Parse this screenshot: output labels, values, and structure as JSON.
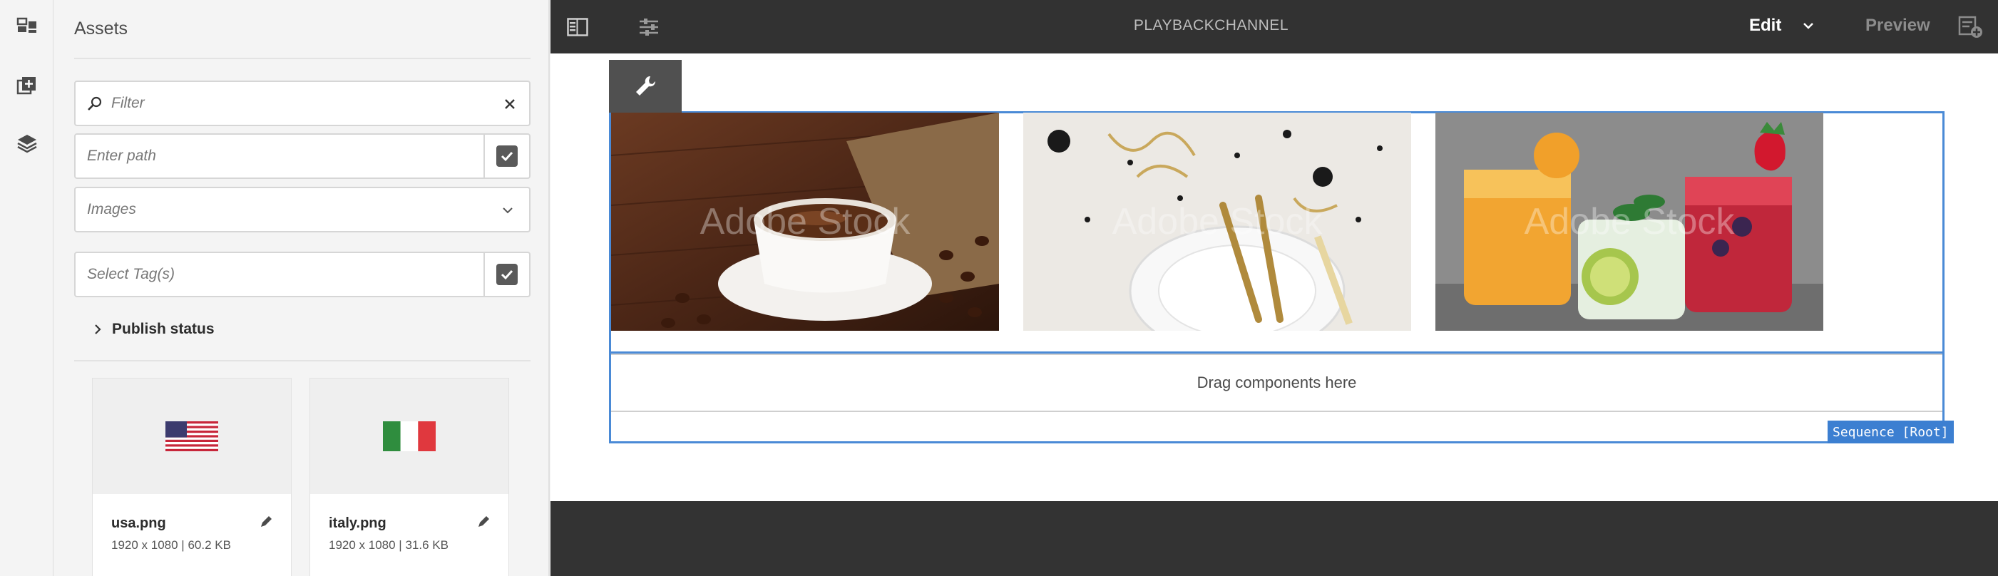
{
  "panel": {
    "title": "Assets",
    "filter": {
      "placeholder": "Filter"
    },
    "path": {
      "placeholder": "Enter path"
    },
    "type_select": {
      "value": "Images"
    },
    "tags": {
      "placeholder": "Select Tag(s)"
    },
    "publish_status": {
      "label": "Publish status"
    },
    "assets": [
      {
        "name": "usa.png",
        "meta": "1920 x 1080 | 60.2 KB",
        "thumb": "flag-usa"
      },
      {
        "name": "italy.png",
        "meta": "1920 x 1080 | 31.6 KB",
        "thumb": "flag-italy"
      }
    ]
  },
  "rail": {
    "items": [
      {
        "icon": "channel-icon"
      },
      {
        "icon": "add-component-icon"
      },
      {
        "icon": "layers-icon"
      }
    ]
  },
  "topbar": {
    "channel_title": "PLAYBACKCHANNEL",
    "mode": "Edit",
    "preview": "Preview"
  },
  "editor": {
    "images": [
      {
        "subject": "coffee",
        "watermark": "Adobe Stock"
      },
      {
        "subject": "party-table-setting",
        "watermark": "Adobe Stock"
      },
      {
        "subject": "cocktails",
        "watermark": "Adobe Stock"
      }
    ],
    "dropzone": "Drag components here",
    "sequence_badge": "Sequence [Root]"
  },
  "colors": {
    "accent": "#4a8ad6",
    "topbar": "#323232",
    "panel_bg": "#f4f4f4"
  }
}
